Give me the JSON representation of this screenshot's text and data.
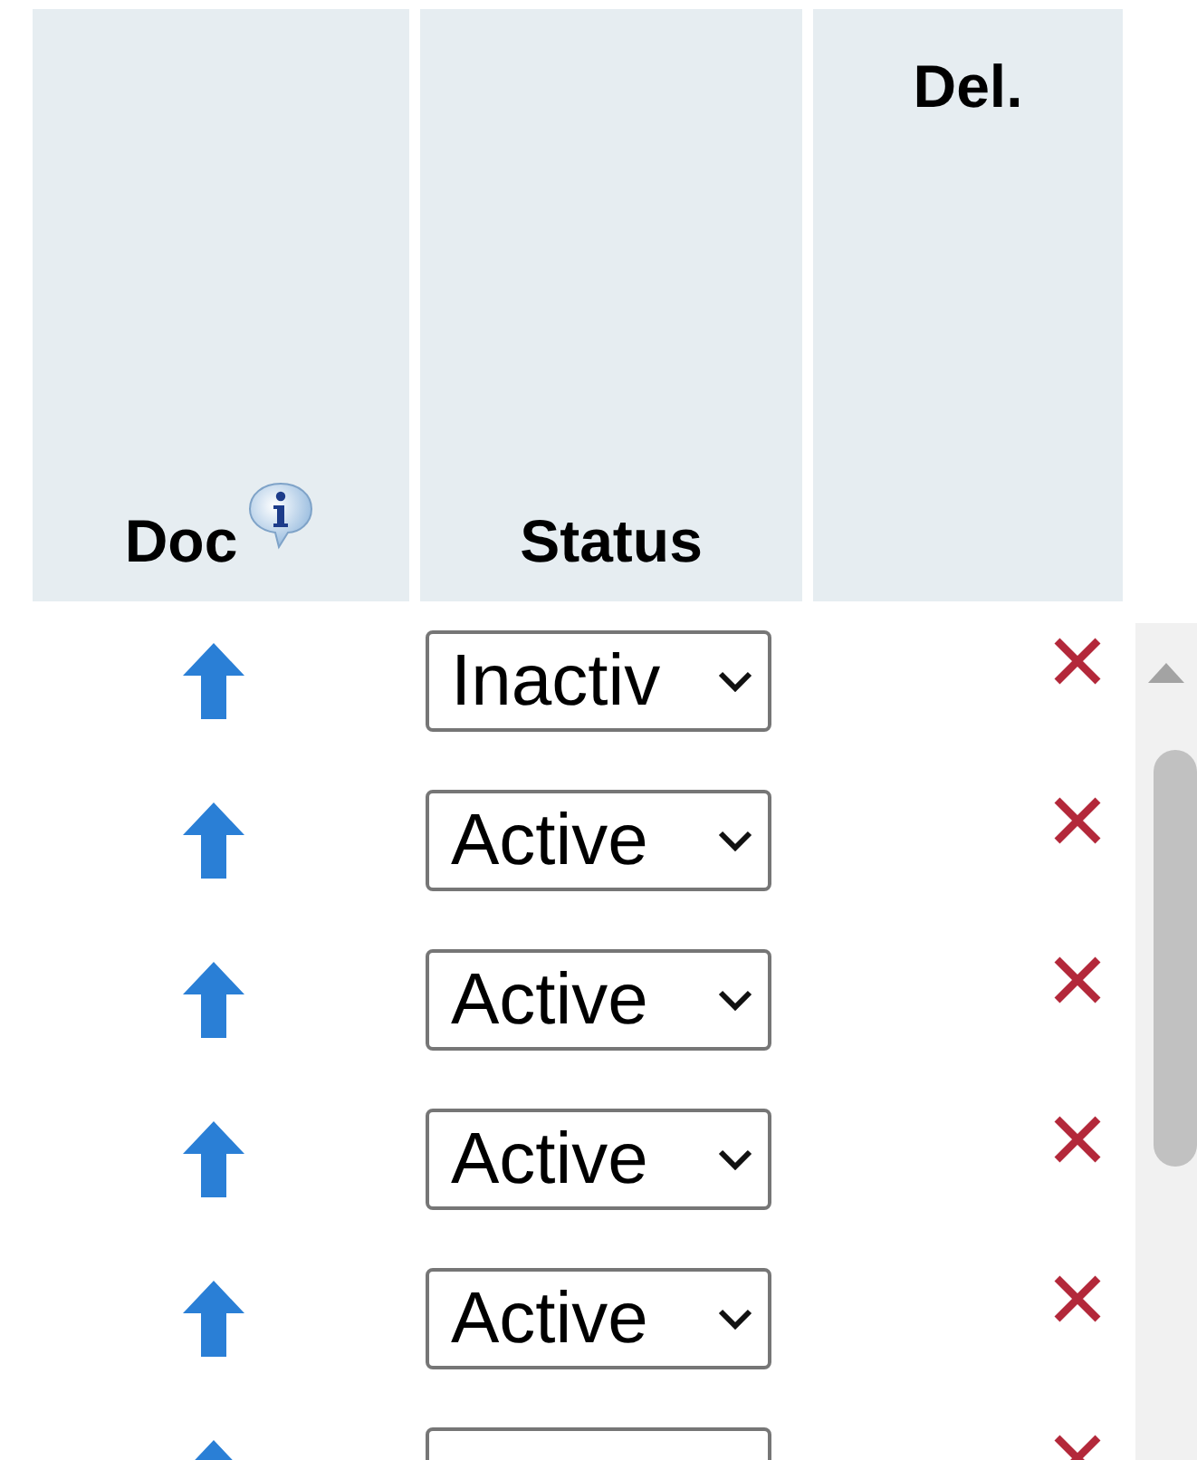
{
  "table": {
    "columns": [
      {
        "kind": "doc",
        "label": "Doc"
      },
      {
        "kind": "status",
        "label": "Status"
      },
      {
        "kind": "delete",
        "label": "Del."
      }
    ],
    "rows": [
      {
        "status": "Inactiv"
      },
      {
        "status": "Active"
      },
      {
        "status": "Active"
      },
      {
        "status": "Active"
      },
      {
        "status": "Active"
      },
      {}
    ]
  }
}
